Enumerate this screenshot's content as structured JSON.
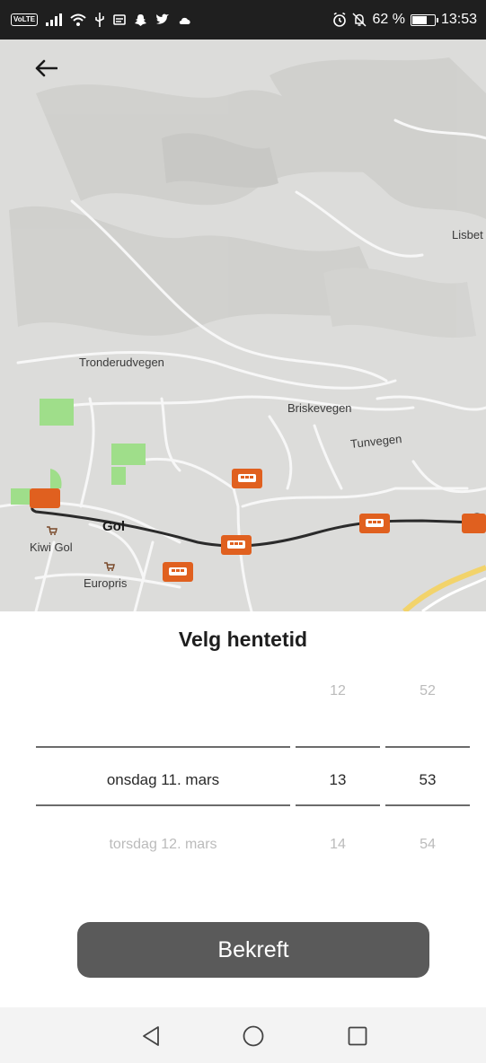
{
  "status_bar": {
    "volte": "VoLTE",
    "battery_text": "62 %",
    "battery_level": 0.62,
    "time": "13:53",
    "icons": [
      "signal-icon",
      "wifi-icon",
      "usb-icon",
      "message-icon",
      "snapchat-icon",
      "twitter-icon",
      "cloud-icon",
      "alarm-icon",
      "mute-icon",
      "battery-icon"
    ]
  },
  "map": {
    "back_icon": "arrow-left-icon",
    "labels": {
      "lisbet": "Lisbet",
      "tronderudvegen": "Tronderudvegen",
      "briskevegen": "Briskevegen",
      "tunvegen": "Tunvegen",
      "gol": "Gol",
      "kiwi_gol": "Kiwi Gol",
      "europris": "Europris"
    },
    "colors": {
      "background": "#dcdcda",
      "bus_stop": "#e0601f",
      "route": "#2b2b2b",
      "park": "#9fde8a",
      "highway": "#f2d36b"
    }
  },
  "picker": {
    "title": "Velg hentetid",
    "date": {
      "above": "",
      "selected": "onsdag 11. mars",
      "below": "torsdag 12. mars"
    },
    "hour": {
      "above": "12",
      "selected": "13",
      "below": "14"
    },
    "minute": {
      "above": "52",
      "selected": "53",
      "below": "54"
    },
    "confirm_label": "Bekreft"
  },
  "nav_bar": {
    "icons": [
      "back-triangle-icon",
      "home-circle-icon",
      "recents-square-icon"
    ]
  }
}
